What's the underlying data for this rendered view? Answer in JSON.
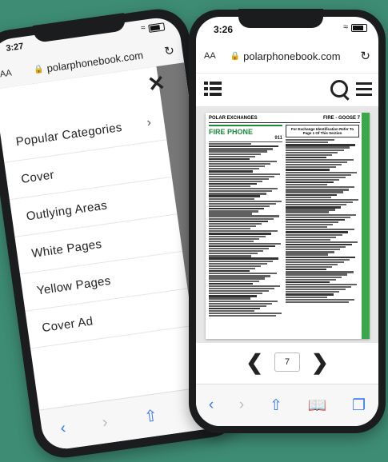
{
  "back_phone": {
    "status": {
      "time": "3:27"
    },
    "url_bar": {
      "text_size": "AA",
      "domain": "polarphonebook.com"
    },
    "menu": {
      "items": [
        {
          "label": "Popular Categories",
          "has_chevron": true
        },
        {
          "label": "Cover"
        },
        {
          "label": "Outlying Areas"
        },
        {
          "label": "White Pages"
        },
        {
          "label": "Yellow Pages"
        },
        {
          "label": "Cover Ad"
        }
      ]
    }
  },
  "front_phone": {
    "status": {
      "time": "3:26"
    },
    "url_bar": {
      "text_size": "AA",
      "domain": "polarphonebook.com"
    },
    "page": {
      "header_left": "POLAR EXCHANGES",
      "header_right": "FIRE - GOOSE  7",
      "section_title": "FIRE PHONE",
      "section_number": "911",
      "notice": "For Exchange Identification Refer To Page 1 Of This Section"
    },
    "pager": {
      "current_page": "7"
    }
  },
  "colors": {
    "background": "#3e8c74",
    "accent_green": "#3aa84a",
    "link_blue": "#3478f6"
  }
}
